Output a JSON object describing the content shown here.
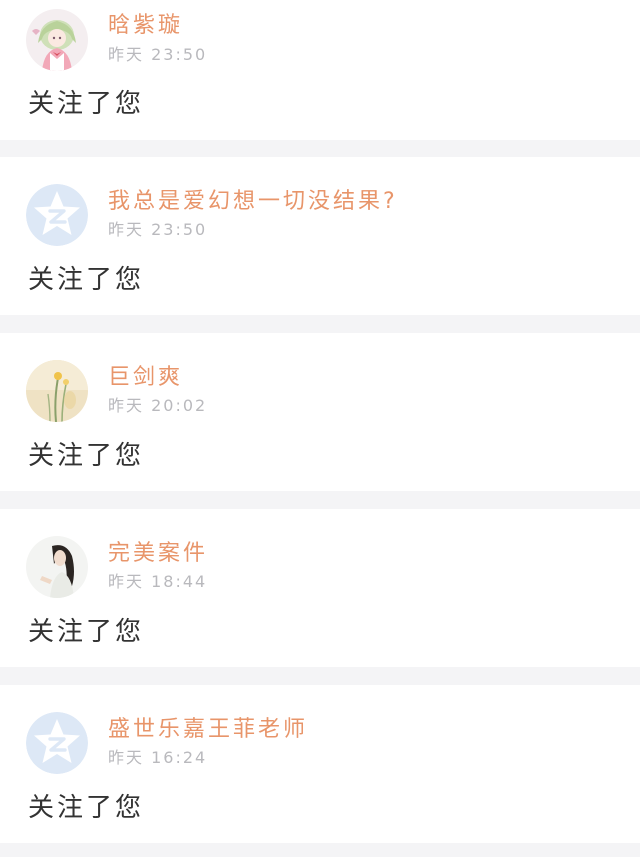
{
  "colors": {
    "background": "#f4f4f6",
    "card": "#ffffff",
    "username": "#e8956a",
    "time": "#b9b9bd",
    "action_text": "#333333",
    "default_avatar_bg": "#dde8f6",
    "default_avatar_fg": "#ffffff"
  },
  "notifications": [
    {
      "username": "晗紫璇",
      "time": "昨天 23:50",
      "action": "关注了您",
      "avatar": "anime-girl-avatar"
    },
    {
      "username": "我总是爱幻想一切没结果?",
      "time": "昨天 23:50",
      "action": "关注了您",
      "avatar": "default-qzone-avatar"
    },
    {
      "username": "巨剑爽",
      "time": "昨天 20:02",
      "action": "关注了您",
      "avatar": "flower-vase-avatar"
    },
    {
      "username": "完美案件",
      "time": "昨天 18:44",
      "action": "关注了您",
      "avatar": "dark-hair-girl-avatar"
    },
    {
      "username": "盛世乐嘉王菲老师",
      "time": "昨天 16:24",
      "action": "关注了您",
      "avatar": "default-qzone-avatar"
    }
  ]
}
